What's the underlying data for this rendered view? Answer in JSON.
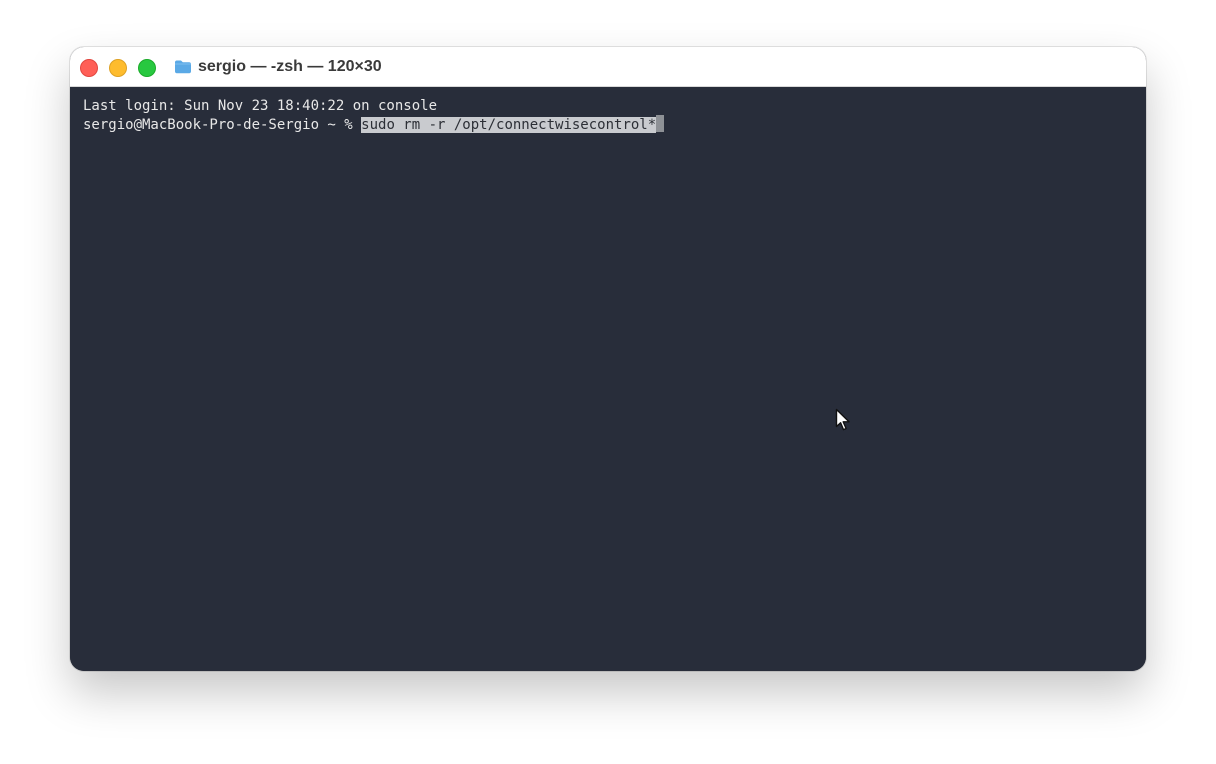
{
  "window": {
    "title": "sergio — -zsh — 120×30",
    "folder_icon": "folder-icon",
    "traffic_lights": {
      "close_icon": "close-icon",
      "minimize_icon": "minimize-icon",
      "zoom_icon": "zoom-icon"
    }
  },
  "terminal": {
    "last_login": "Last login: Sun Nov 23 18:40:22 on console",
    "prompt": "sergio@MacBook-Pro-de-Sergio ~ % ",
    "command": "sudo rm -r /opt/connectwisecontrol*"
  },
  "colors": {
    "terminal_background": "#282d3a",
    "terminal_text": "#e8e8e8",
    "selection": "#c9cbcf",
    "close": "#ff5f57",
    "minimize": "#febc2e",
    "zoom": "#28c840",
    "folder": "#5aa9e6"
  },
  "pointer": "mouse-pointer-icon"
}
